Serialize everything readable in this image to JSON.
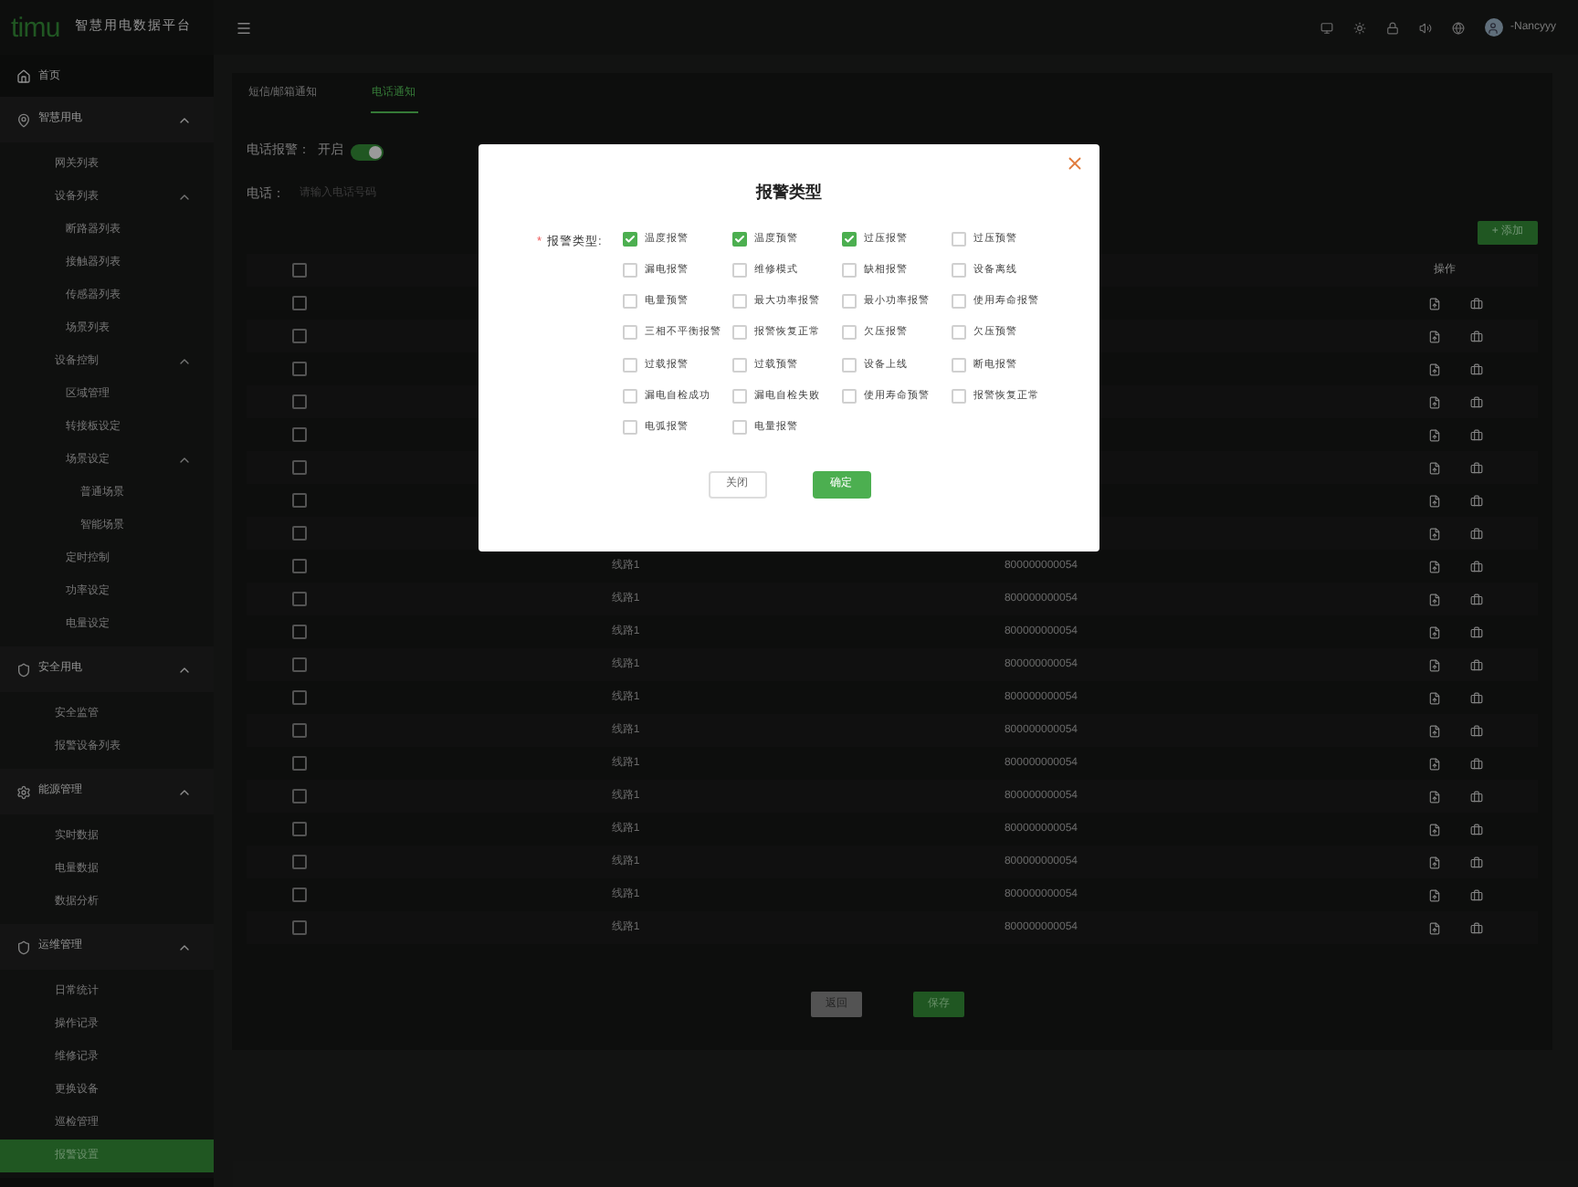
{
  "header": {
    "logo": "timu",
    "title": "智慧用电数据平台",
    "user": "-Nancyyy"
  },
  "sidebar": {
    "items": [
      {
        "kind": "link",
        "label": "首页",
        "selected": false
      },
      {
        "kind": "group",
        "label": "智慧用电",
        "expanded": true,
        "children": [
          {
            "kind": "link",
            "label": "网关列表",
            "selected": false
          },
          {
            "kind": "group",
            "label": "设备列表",
            "expanded": true,
            "children": [
              {
                "kind": "link",
                "label": "断路器列表",
                "selected": false
              },
              {
                "kind": "link",
                "label": "接触器列表",
                "selected": false
              },
              {
                "kind": "link",
                "label": "传感器列表",
                "selected": false
              },
              {
                "kind": "link",
                "label": "场景列表",
                "selected": false
              }
            ]
          },
          {
            "kind": "group",
            "label": "设备控制",
            "expanded": true,
            "children": [
              {
                "kind": "link",
                "label": "区域管理",
                "selected": false
              },
              {
                "kind": "link",
                "label": "转接板设定",
                "selected": false
              },
              {
                "kind": "group",
                "label": "场景设定",
                "expanded": true,
                "children": [
                  {
                    "kind": "link",
                    "label": "普通场景",
                    "selected": false
                  },
                  {
                    "kind": "link",
                    "label": "智能场景",
                    "selected": false
                  }
                ]
              },
              {
                "kind": "link",
                "label": "定时控制",
                "selected": false
              },
              {
                "kind": "link",
                "label": "功率设定",
                "selected": false
              },
              {
                "kind": "link",
                "label": "电量设定",
                "selected": false
              }
            ]
          }
        ]
      },
      {
        "kind": "group",
        "label": "安全用电",
        "expanded": true,
        "children": [
          {
            "kind": "link",
            "label": "安全监管",
            "selected": false
          },
          {
            "kind": "link",
            "label": "报警设备列表",
            "selected": false
          }
        ]
      },
      {
        "kind": "group",
        "label": "能源管理",
        "expanded": true,
        "children": [
          {
            "kind": "link",
            "label": "实时数据",
            "selected": false
          },
          {
            "kind": "link",
            "label": "电量数据",
            "selected": false
          },
          {
            "kind": "link",
            "label": "数据分析",
            "selected": false
          }
        ]
      },
      {
        "kind": "group",
        "label": "运维管理",
        "expanded": true,
        "children": [
          {
            "kind": "link",
            "label": "日常统计",
            "selected": false
          },
          {
            "kind": "link",
            "label": "操作记录",
            "selected": false
          },
          {
            "kind": "link",
            "label": "维修记录",
            "selected": false
          },
          {
            "kind": "link",
            "label": "更换设备",
            "selected": false
          },
          {
            "kind": "link",
            "label": "巡检管理",
            "selected": false
          },
          {
            "kind": "link",
            "label": "报警设置",
            "selected": true
          }
        ]
      }
    ]
  },
  "tabs": [
    {
      "label": "短信/邮箱通知",
      "selected": false
    },
    {
      "label": "电话通知",
      "selected": true
    }
  ],
  "phone_alarm": {
    "label": "电话报警：",
    "state_text": "开启",
    "on": true
  },
  "phone": {
    "label": "电话：",
    "placeholder": "请输入电话号码"
  },
  "add_button": "+ 添加",
  "table": {
    "columns": [
      "操作"
    ],
    "header_checked": false,
    "rows": [
      {
        "checked": false
      },
      {
        "checked": false
      },
      {
        "checked": false
      },
      {
        "checked": false
      },
      {
        "checked": false
      },
      {
        "checked": false
      },
      {
        "checked": false
      },
      {
        "checked": false
      },
      {
        "checked": false,
        "line": "线路1",
        "number": "800000000054"
      },
      {
        "checked": false,
        "line": "线路1",
        "number": "800000000054"
      },
      {
        "checked": false,
        "line": "线路1",
        "number": "800000000054"
      },
      {
        "checked": false,
        "line": "线路1",
        "number": "800000000054"
      },
      {
        "checked": false,
        "line": "线路1",
        "number": "800000000054"
      },
      {
        "checked": false,
        "line": "线路1",
        "number": "800000000054"
      },
      {
        "checked": false,
        "line": "线路1",
        "number": "800000000054"
      },
      {
        "checked": false,
        "line": "线路1",
        "number": "800000000054"
      },
      {
        "checked": false,
        "line": "线路1",
        "number": "800000000054"
      },
      {
        "checked": false,
        "line": "线路1",
        "number": "800000000054"
      },
      {
        "checked": false,
        "line": "线路1",
        "number": "800000000054"
      },
      {
        "checked": false,
        "line": "线路1",
        "number": "800000000054"
      }
    ]
  },
  "footer_buttons": [
    {
      "label": "返回",
      "kind": "secondary"
    },
    {
      "label": "保存",
      "kind": "primary"
    }
  ],
  "dialog": {
    "title": "报警类型",
    "required_mark": "*",
    "field_label": "报警类型:",
    "options": [
      {
        "label": "温度报警",
        "checked": true
      },
      {
        "label": "温度预警",
        "checked": true
      },
      {
        "label": "过压报警",
        "checked": true
      },
      {
        "label": "过压预警",
        "checked": false
      },
      {
        "label": "漏电报警",
        "checked": false
      },
      {
        "label": "维修模式",
        "checked": false
      },
      {
        "label": "缺相报警",
        "checked": false
      },
      {
        "label": "设备离线",
        "checked": false
      },
      {
        "label": "电量预警",
        "checked": false
      },
      {
        "label": "最大功率报警",
        "checked": false
      },
      {
        "label": "最小功率报警",
        "checked": false
      },
      {
        "label": "使用寿命报警",
        "checked": false
      },
      {
        "label": "三相不平衡报警",
        "checked": false
      },
      {
        "label": "报警恢复正常",
        "checked": false
      },
      {
        "label": "欠压报警",
        "checked": false
      },
      {
        "label": "欠压预警",
        "checked": false
      },
      {
        "label": "过载报警",
        "checked": false
      },
      {
        "label": "过载预警",
        "checked": false
      },
      {
        "label": "设备上线",
        "checked": false
      },
      {
        "label": "断电报警",
        "checked": false
      },
      {
        "label": "漏电自检成功",
        "checked": false
      },
      {
        "label": "漏电自检失败",
        "checked": false
      },
      {
        "label": "使用寿命预警",
        "checked": false
      },
      {
        "label": "报警恢复正常",
        "checked": false
      },
      {
        "label": "电弧报警",
        "checked": false
      },
      {
        "label": "电量报警",
        "checked": false
      }
    ],
    "buttons": [
      {
        "label": "关闭",
        "kind": "secondary"
      },
      {
        "label": "确定",
        "kind": "primary"
      }
    ]
  }
}
